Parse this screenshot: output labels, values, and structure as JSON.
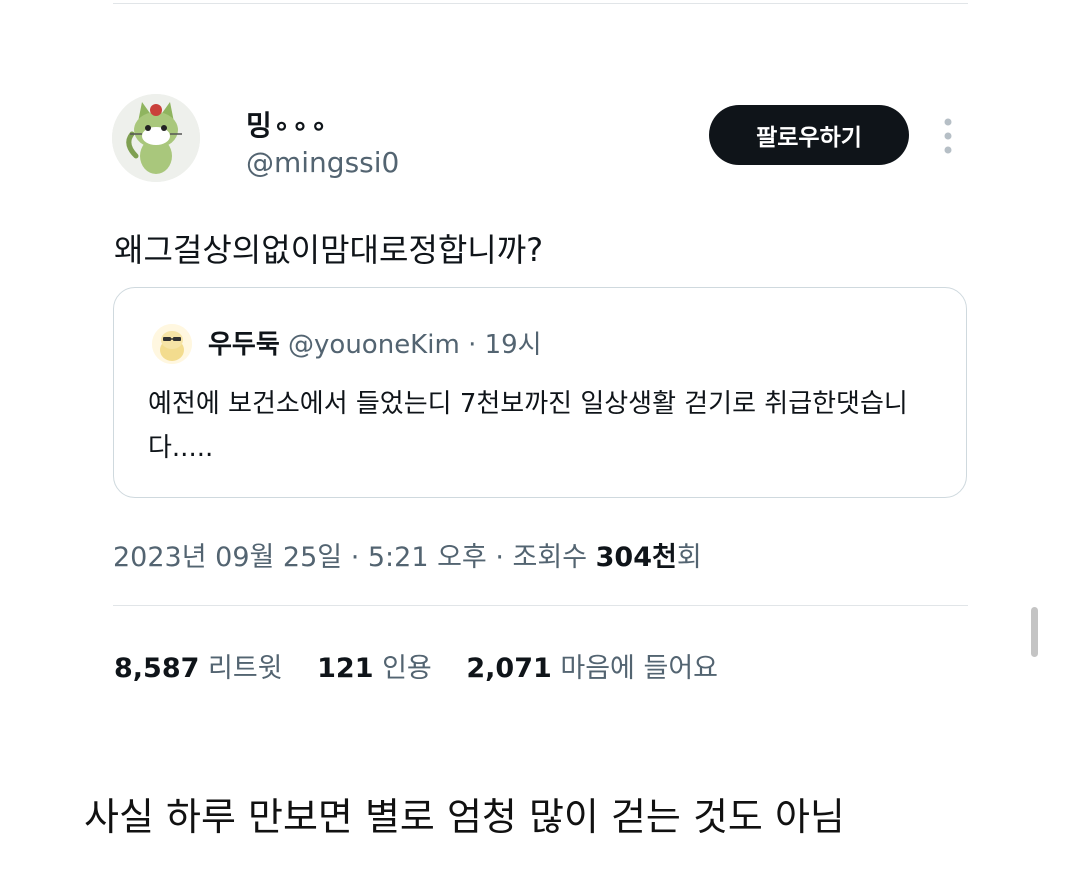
{
  "author": {
    "display_name": "밍∘∘∘",
    "handle": "@mingssi0"
  },
  "follow_button_label": "팔로우하기",
  "more_icon": "vertical-ellipsis-icon",
  "tweet_text": "왜그걸상의없이맘대로정합니까?",
  "quoted_tweet": {
    "display_name": "우두둑",
    "handle": "@youoneKim",
    "separator": "·",
    "time": "19시",
    "text": "예전에 보건소에서 들었는디 7천보까진 일상생활 걷기로 취급한댓습니다....."
  },
  "meta": {
    "date": "2023년 09월 25일",
    "separator1": " · ",
    "time": "5:21 오후",
    "separator2": " · ",
    "views_label": "조회수 ",
    "views_value": "304천",
    "views_suffix": "회"
  },
  "stats": {
    "retweets_value": "8,587",
    "retweets_label": "리트윗",
    "quotes_value": "121",
    "quotes_label": "인용",
    "likes_value": "2,071",
    "likes_label": "마음에 들어요"
  },
  "caption": "사실 하루 만보면 별로 엄청 많이 걷는 것도 아님"
}
